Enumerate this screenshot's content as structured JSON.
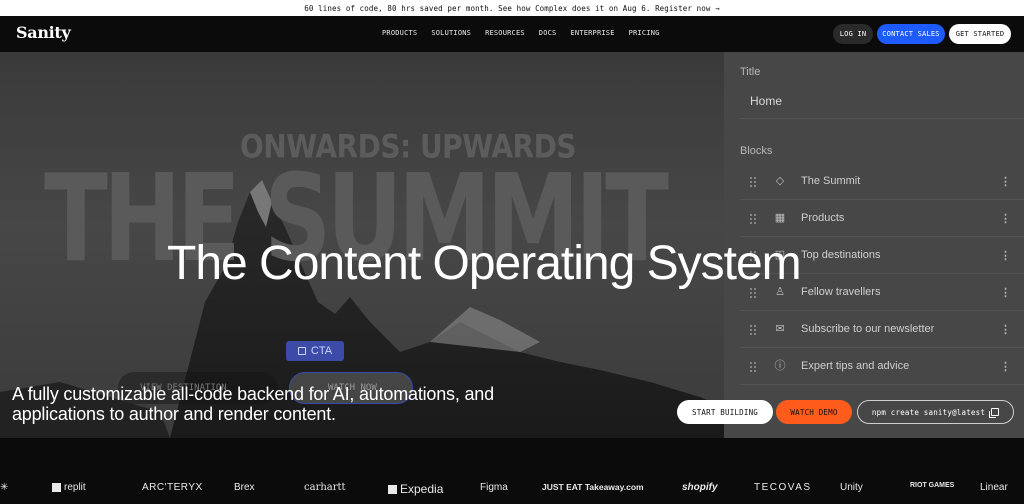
{
  "announcement": "60 lines of code, 80 hrs saved per month. See how Complex does it on Aug 6. Register now →",
  "nav": {
    "logo": "Sanity",
    "menu": [
      "PRODUCTS",
      "SOLUTIONS",
      "RESOURCES",
      "DOCS",
      "ENTERPRISE",
      "PRICING"
    ],
    "login": "LOG IN",
    "contact_sales": "CONTACT SALES",
    "get_started": "GET STARTED"
  },
  "hero": {
    "bg_top_text": "ONWARDS: UPWARDS",
    "bg_big_text": "THE SUMMIT",
    "cta_chip": "CTA",
    "ghost_destination": "VIEW DESTINATION",
    "ghost_watch": "WATCH NOW",
    "headline": "The Content Operating System",
    "subheadline": "A fully customizable all-code backend for AI, automations, and applications to author and render content.",
    "buttons": {
      "start_building": "START BUILDING",
      "watch_demo": "WATCH DEMO",
      "npm_command": "npm create sanity@latest"
    }
  },
  "panel": {
    "title_label": "Title",
    "title_value": "Home",
    "blocks_label": "Blocks",
    "blocks": [
      {
        "label": "The Summit",
        "icon": "diamond-icon"
      },
      {
        "label": "Products",
        "icon": "grid-icon"
      },
      {
        "label": "Top destinations",
        "icon": "gallery-icon"
      },
      {
        "label": "Fellow travellers",
        "icon": "user-icon"
      },
      {
        "label": "Subscribe to our newsletter",
        "icon": "envelope-icon"
      },
      {
        "label": "Expert tips and advice",
        "icon": "info-icon"
      }
    ]
  },
  "logos": [
    "replit",
    "ARC'TERYX",
    "Brex",
    "carhartt",
    "Expedia",
    "Figma",
    "JUST EAT Takeaway.com",
    "shopify",
    "TECOVAS",
    "Unity",
    "RIOT GAMES",
    "Linear"
  ],
  "colors": {
    "accent_blue": "#1e5bff",
    "accent_orange": "#ff5c1b",
    "background": "#0b0b0b"
  }
}
